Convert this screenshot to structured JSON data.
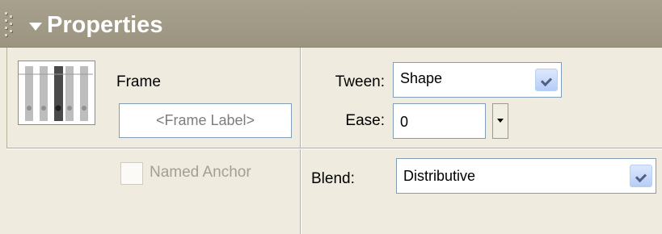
{
  "panel": {
    "title": "Properties"
  },
  "frame": {
    "heading": "Frame",
    "label_placeholder": "<Frame Label>",
    "named_anchor_label": "Named Anchor",
    "named_anchor_checked": false
  },
  "tween": {
    "label": "Tween:",
    "value": "Shape",
    "ease_label": "Ease:",
    "ease_value": "0"
  },
  "blend": {
    "label": "Blend:",
    "value": "Distributive"
  },
  "icons": {
    "grip": "drag-grip-icon",
    "collapse": "collapse-triangle-icon",
    "frame_thumb": "frame-timeline-icon",
    "dropdown": "chevron-down-icon",
    "spinner": "popup-slider-arrow-icon"
  }
}
